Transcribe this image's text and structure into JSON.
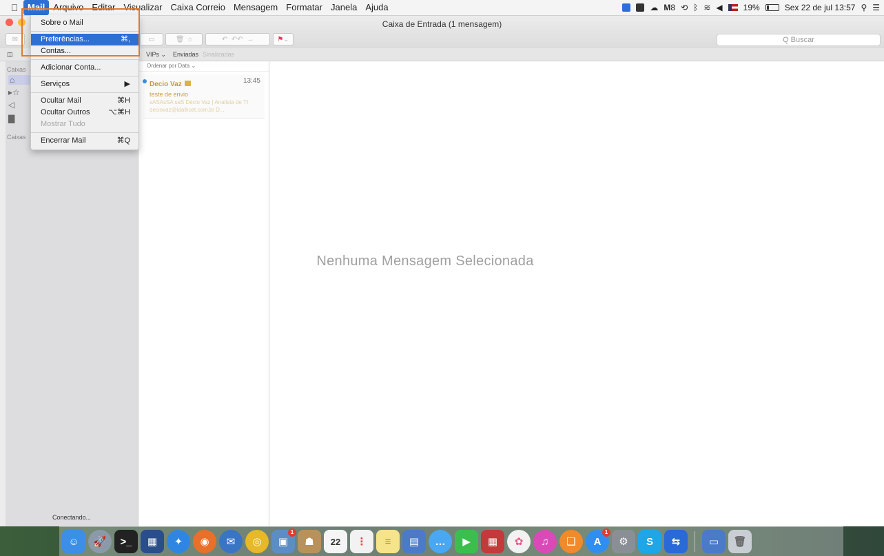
{
  "menubar": {
    "apple_icon": "apple-logo-icon",
    "items": [
      "Mail",
      "Arquivo",
      "Editar",
      "Visualizar",
      "Caixa Correio",
      "Mensagem",
      "Formatar",
      "Janela",
      "Ajuda"
    ],
    "right": {
      "battery": "19%",
      "datetime": "Sex 22 de jul 13:57",
      "extra_label": "8"
    }
  },
  "window": {
    "title": "Caixa de Entrada (1 mensagem)",
    "search_placeholder": "Q Buscar",
    "favorites": {
      "vips": "VIPs ⌄",
      "sent": "Enviadas",
      "flagged": "Sinalizadas"
    }
  },
  "sidebar": {
    "section_1": "Caixas",
    "section_2": "Caixas",
    "status": "Conectando..."
  },
  "message_list": {
    "sort_label": "Ordenar por Data ⌄",
    "messages": [
      {
        "from": "Decio Vaz",
        "time": "13:45",
        "subject": "teste de envio",
        "preview": "sASAsSA saS Décio Vaz | Analista de TI deciovaz@idalhost.com.br D..."
      }
    ]
  },
  "reading_pane": {
    "empty_text": "Nenhuma Mensagem Selecionada"
  },
  "mail_menu": {
    "about": "Sobre o Mail",
    "preferences": "Preferências...",
    "preferences_shortcut": "⌘,",
    "accounts": "Contas...",
    "add_account": "Adicionar Conta...",
    "services": "Serviços",
    "hide_mail": "Ocultar Mail",
    "hide_mail_shortcut": "⌘H",
    "hide_others": "Ocultar Outros",
    "hide_others_shortcut": "⌥⌘H",
    "show_all": "Mostrar Tudo",
    "quit": "Encerrar Mail",
    "quit_shortcut": "⌘Q"
  },
  "dock": {
    "calendar_day": "22",
    "badges": {
      "photo_app": "1",
      "app_store": "1"
    },
    "colors": {
      "finder": "#3c8ee6",
      "launchpad": "#8b9aa8",
      "terminal": "#222222",
      "flipboard": "#2a4e8a",
      "safari": "#2f86e2",
      "firefox": "#e8702a",
      "thunderbird": "#3a74c4",
      "chrome": "#e6b82a",
      "preview": "#5b8ec4",
      "contacts": "#b8925a",
      "calendar": "#f5f5f5",
      "reminders": "#f2f2f2",
      "notes": "#f6e48a",
      "photo_booth": "#c23a3a",
      "messages": "#4aa8f2",
      "facetime": "#3cbe4e",
      "photos": "#f2f2f2",
      "itunes": "#d94ab8",
      "ibooks": "#f08a2a",
      "app_store": "#2e8ff0",
      "system_prefs": "#8a8f96",
      "skype": "#1ea6e6",
      "teamviewer": "#2a6ad6",
      "screen": "#4a7ac8",
      "trash": "#c9ced4"
    }
  }
}
